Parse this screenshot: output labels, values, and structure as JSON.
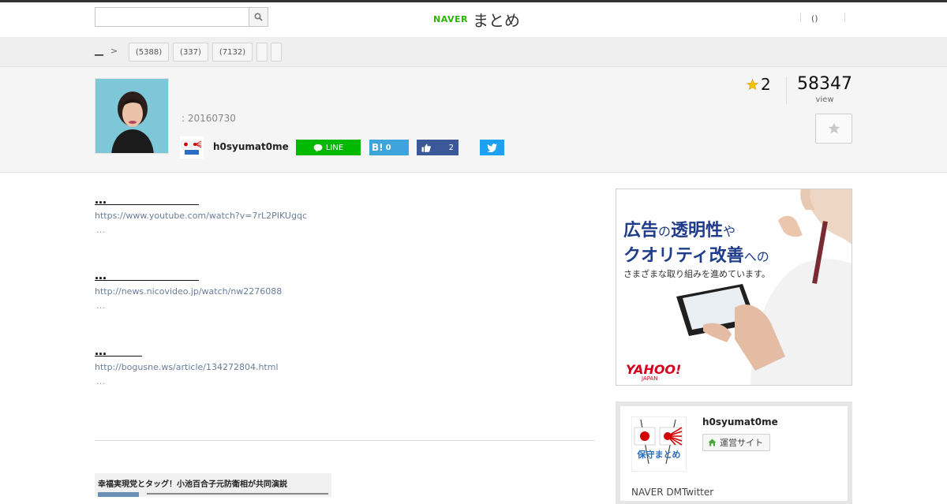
{
  "header": {
    "search_placeholder": "",
    "logo_naver": "NAVER",
    "logo_matome": "まとめ",
    "right_link": "()"
  },
  "breadcrumb": {
    "home": "__",
    "tags": [
      "(5388)",
      "(337)",
      "(7132)",
      "",
      ""
    ]
  },
  "summary": {
    "date": ": 20160730",
    "author": "h0syumat0me",
    "share_line_label": "LINE",
    "share_hatena_label": "B!",
    "share_hatena_count": "0",
    "share_fb_count": "2",
    "fav_count": "2",
    "views": "58347",
    "views_label": "view"
  },
  "items": [
    {
      "title": "…",
      "url": "https://www.youtube.com/watch?v=7rL2PIKUgqc",
      "desc": "…"
    },
    {
      "title": "…",
      "url": "http://news.nicovideo.jp/watch/nw2276088",
      "desc": "…"
    },
    {
      "title": "…",
      "url": "http://bogusne.ws/article/134272804.html",
      "desc": "…"
    }
  ],
  "embed": {
    "title": "幸福実現党とタッグ！小池百合子元防衛相が共同演説"
  },
  "ad": {
    "line1_a": "広告",
    "line1_b": "の",
    "line1_c": "透明性",
    "line1_d": "や",
    "line2_a": "クオリティ改善",
    "line2_b": "への",
    "line3": "さまざまな取り組みを進めています。",
    "brand": "YAHOO!",
    "brand_sub": "JAPAN"
  },
  "profile": {
    "name": "h0syumat0me",
    "site_label": "運営サイト",
    "desc": "NAVER DMTwitter"
  },
  "colors": {
    "naver_green": "#2db400",
    "line_green": "#00b900",
    "hatena_blue": "#3da4dc",
    "facebook_blue": "#3b5998",
    "twitter_blue": "#1da1f2",
    "ad_blue": "#1f3c8a",
    "yahoo_red": "#d6001c"
  }
}
